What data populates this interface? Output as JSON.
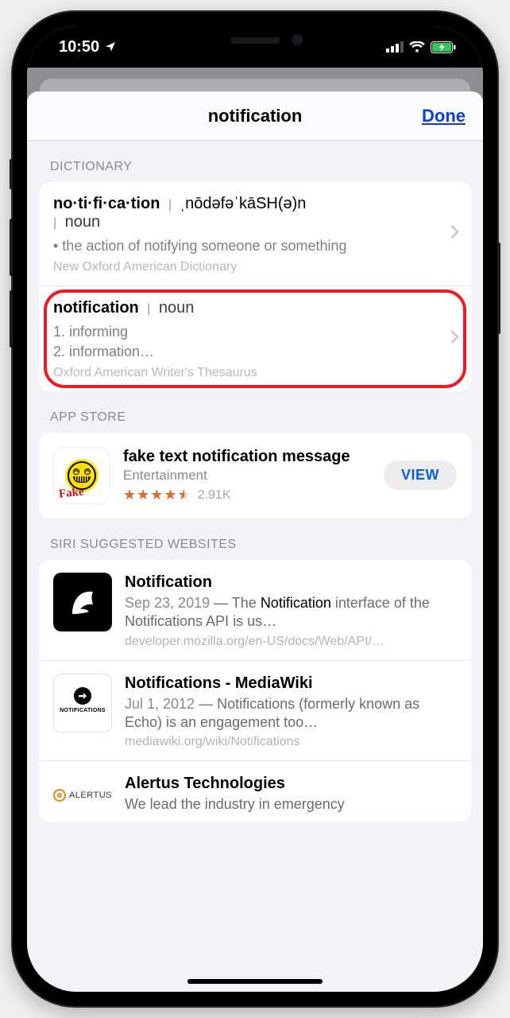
{
  "status": {
    "time": "10:50"
  },
  "sheet": {
    "title": "notification",
    "done": "Done"
  },
  "dictionary": {
    "label": "DICTIONARY",
    "entries": [
      {
        "word": "no·ti·fi·ca·tion",
        "pron": "ˌnōdəfəˈkāSH(ə)n",
        "pos": "noun",
        "body": "• the action of notifying someone or something",
        "source": "New Oxford American Dictionary"
      },
      {
        "word": "notification",
        "pos": "noun",
        "body": "1. informing\n2. information…",
        "source": "Oxford American Writer's Thesaurus"
      }
    ]
  },
  "appstore": {
    "label": "APP STORE",
    "app": {
      "title": "fake text notification message",
      "category": "Entertainment",
      "rating": 4.5,
      "count": "2.91K",
      "view": "VIEW",
      "icon_badge": "Fake"
    }
  },
  "siri": {
    "label": "SIRI SUGGESTED WEBSITES",
    "items": [
      {
        "title": "Notification",
        "date": "Sep 23, 2019",
        "desc_pre": " — The ",
        "desc_strong": "Notification",
        "desc_post": " interface of the Notifications API is us…",
        "url": "developer.mozilla.org/en-US/docs/Web/API/…",
        "icon": "mdn"
      },
      {
        "title": "Notifications - MediaWiki",
        "date": "Jul 1, 2012",
        "desc_pre": " — Notifications (formerly known as Echo) is an engagement too…",
        "desc_strong": "",
        "desc_post": "",
        "url": "mediawiki.org/wiki/Notifications",
        "icon": "mw",
        "mw_label": "NOTIFICATIONS"
      },
      {
        "title": "Alertus Technologies",
        "date": "",
        "desc_pre": "We lead the industry in emergency ",
        "desc_strong": "",
        "desc_post": "",
        "url": "",
        "icon": "alertus",
        "alertus_text": "ALERTUS"
      }
    ]
  }
}
